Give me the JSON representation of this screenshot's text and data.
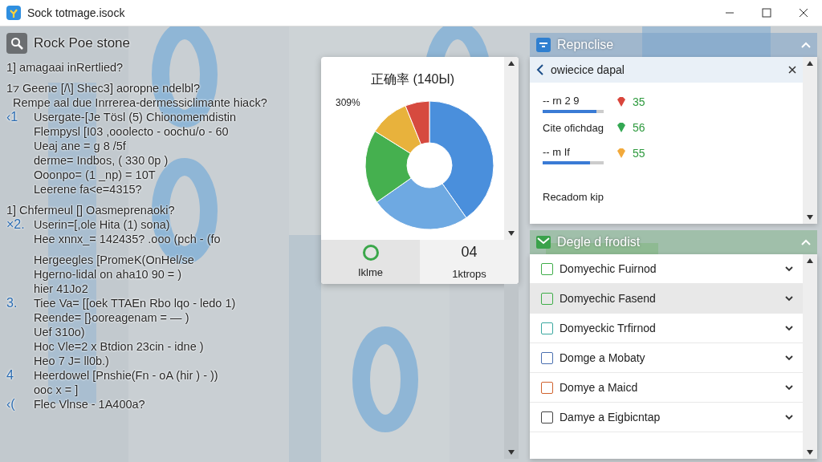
{
  "window": {
    "title": "Sock totmage.isock"
  },
  "left_panel": {
    "title": "Rock Poe stone",
    "lines": [
      {
        "kind": "question",
        "text": "1] amagaai inRertlied?"
      },
      {
        "kind": "question",
        "text": "1⁊ Geene [/\\] Shec3] aoropne ndelbl?"
      },
      {
        "kind": "plain",
        "text": "Rempe aal due Inrrerea-dermessiclimante hiack?"
      },
      {
        "kind": "item",
        "marker": "‹1",
        "text": "Usergate-[Je Tösl (5) Chionomemdistin"
      },
      {
        "kind": "line",
        "text": "Flempysl [I03 ,ooolecto    - oochu/o   -  60"
      },
      {
        "kind": "line",
        "text": "Ueaj ane = g 8 /5f"
      },
      {
        "kind": "line",
        "text": "derme= Indbos,   ( 330 0p )"
      },
      {
        "kind": "line",
        "text": "Ooonpo= (1 _np) = 10T"
      },
      {
        "kind": "line",
        "text": "Leerene fa<e=4315?"
      },
      {
        "kind": "question",
        "text": "1] Chfermeul [] Oasmeprenaoki?"
      },
      {
        "kind": "item",
        "marker": "×2.",
        "text": "Userin=[,ole Hita (1) sona)"
      },
      {
        "kind": "line",
        "text": "Hee xnnx_= 142435?       .ooo (pch  -  (fo"
      },
      {
        "kind": "gap",
        "text": "Hergeegles [PromeK(OnHel/se"
      },
      {
        "kind": "line",
        "text": "Hgerno-lidal on aha10 90 = )"
      },
      {
        "kind": "line",
        "text": "hier 41Jo2"
      },
      {
        "kind": "item",
        "marker": "3.",
        "text": "Tiee Va= [[oek TTAEn  Rbo lqo  -  ledo 1)"
      },
      {
        "kind": "line",
        "text": "Reende= [}ooreagenam = — )"
      },
      {
        "kind": "line",
        "text": "Uef 310o)"
      },
      {
        "kind": "line",
        "text": "Hoc Vle=2 x Btdion 23cin - idne )"
      },
      {
        "kind": "line",
        "text": "Heo 7 J= ll0b.)"
      },
      {
        "kind": "item",
        "marker": "4",
        "text": "Heerdowel [Pnshie(Fn  - oA (hir )      - ))"
      },
      {
        "kind": "line",
        "text": "ooc x = ]"
      },
      {
        "kind": "item",
        "marker": "‹(",
        "text": "Flec Vlnse - 1A400a?"
      }
    ]
  },
  "result_card": {
    "title": "正确率 (140Ы)",
    "slice_label": "309%",
    "tiles": [
      {
        "kind": "ring",
        "label": "Iklme",
        "selected": true
      },
      {
        "kind": "value",
        "value": "04",
        "label": "1ktrops",
        "selected": false
      }
    ]
  },
  "report_panel": {
    "title": "Repnclise",
    "card": {
      "title": "owiecice dapal",
      "rows": [
        {
          "kind": "bar",
          "label": "-- rn 2 9",
          "level": 0.88,
          "color": "#d9453b",
          "value": "35"
        },
        {
          "kind": "text",
          "label": "Cite ofichdag",
          "color": "#34a853",
          "value": "56"
        },
        {
          "kind": "bar",
          "label": "-- m If",
          "level": 0.78,
          "color": "#f2a93b",
          "value": "55"
        }
      ],
      "footer": "Recadom kip"
    }
  },
  "list_panel": {
    "title": "Degle d frodist",
    "items": [
      {
        "label": "Domyechic Fuirnod",
        "color": "#3fae49",
        "selected": false
      },
      {
        "label": "Domyechic Fasend",
        "color": "#3fae49",
        "selected": true
      },
      {
        "label": "Domyeckic Trfirnod",
        "color": "#3aa8a0",
        "selected": false
      },
      {
        "label": "Domge a Mobaty",
        "color": "#4a6fb0",
        "selected": false
      },
      {
        "label": "Domye a Maicd",
        "color": "#d0622e",
        "selected": false
      },
      {
        "label": "Damye a Eigbicntap",
        "color": "#444444",
        "selected": false
      }
    ]
  }
}
